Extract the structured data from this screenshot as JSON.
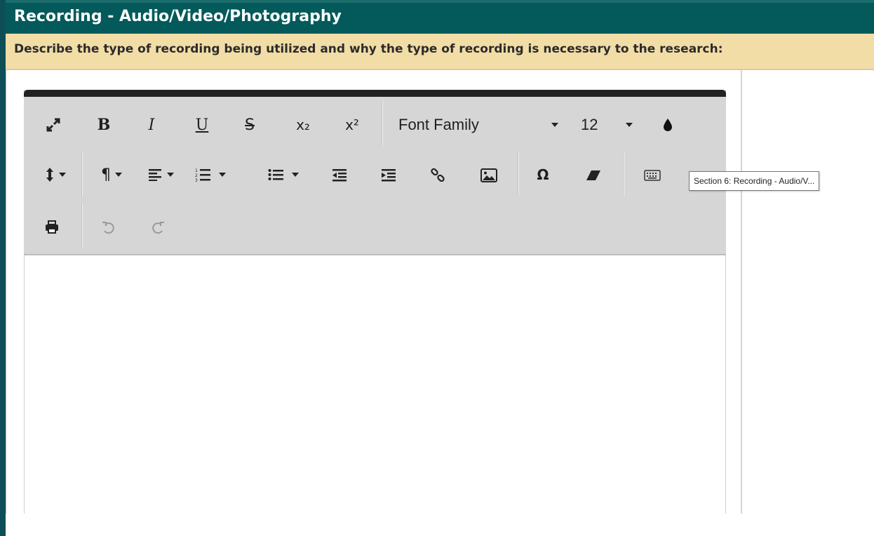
{
  "section": {
    "title": "Recording - Audio/Video/Photography"
  },
  "question": {
    "text": "Describe the type of recording being utilized and why the type of recording is necessary to the research:"
  },
  "toolbar": {
    "row1": [
      {
        "name": "fullscreen-icon",
        "glyph": ""
      },
      {
        "name": "bold-button",
        "glyph": "B"
      },
      {
        "name": "italic-button",
        "glyph": "I"
      },
      {
        "name": "underline-button",
        "glyph": "U"
      },
      {
        "name": "strikethrough-button",
        "glyph": "S"
      },
      {
        "name": "subscript-button",
        "glyph": "x₂"
      },
      {
        "name": "superscript-button",
        "glyph": "x²"
      }
    ],
    "font_family": "Font Family",
    "font_size": "12",
    "text_color_icon": "droplet-icon",
    "row2_icons": [
      "line-height-icon",
      "paragraph-icon",
      "align-icon",
      "ordered-list-icon",
      "unordered-list-icon",
      "outdent-icon",
      "indent-icon",
      "link-icon",
      "image-icon",
      "omega-icon",
      "eraser-icon",
      "keyboard-icon"
    ],
    "row3_icons": [
      "print-icon",
      "undo-icon",
      "redo-icon"
    ],
    "labels": {
      "bold": "B",
      "italic": "I",
      "underline": "U",
      "strike": "S",
      "subscript": "x₂",
      "superscript": "x²",
      "omega": "Ω"
    }
  },
  "tooltip": {
    "text": "Section 6: Recording - Audio/V..."
  },
  "colors": {
    "header_bg": "#045a5a",
    "question_bg": "#f2dda7",
    "toolbar_bg": "#d6d6d6"
  }
}
